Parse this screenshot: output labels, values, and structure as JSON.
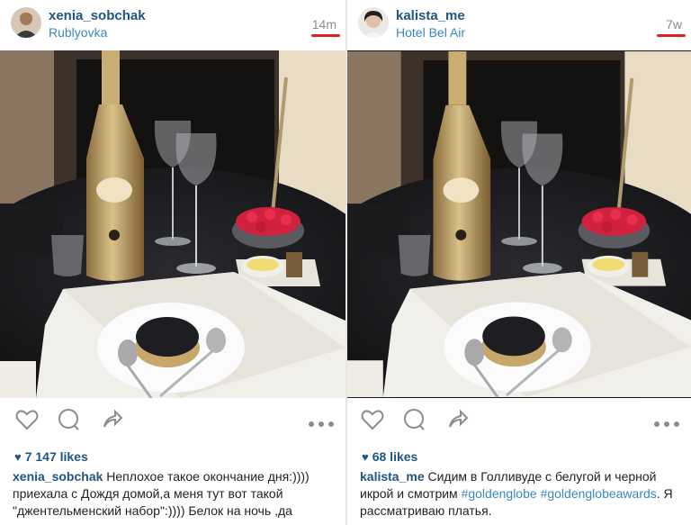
{
  "left_post": {
    "username": "xenia_sobchak",
    "location": "Rublyovka",
    "time": "14m",
    "likes": "7 147 likes",
    "caption_user": "xenia_sobchak",
    "caption_text": "Неплохое такое окончание дня:)))) приехала с Дождя домой,а меня тут вот такой \"джентельменский набор\":)))) Белок на ночь ,да"
  },
  "right_post": {
    "username": "kalista_me",
    "location": "Hotel Bel Air",
    "time": "7w",
    "likes": "68 likes",
    "caption_user": "kalista_me",
    "caption_text_1": "Сидим в Голливуде с белугой и черной икрой и смотрим ",
    "hashtag_1": "#goldenglobe",
    "hashtag_2": "#goldenglobeawards",
    "caption_text_2": ". Я рассматриваю платья."
  },
  "icons": [
    "heart-icon",
    "comment-icon",
    "share-icon",
    "more-options-icon"
  ],
  "colors": {
    "username": "#1e5585",
    "link": "#3a87c2",
    "highlight": "#e02020"
  }
}
